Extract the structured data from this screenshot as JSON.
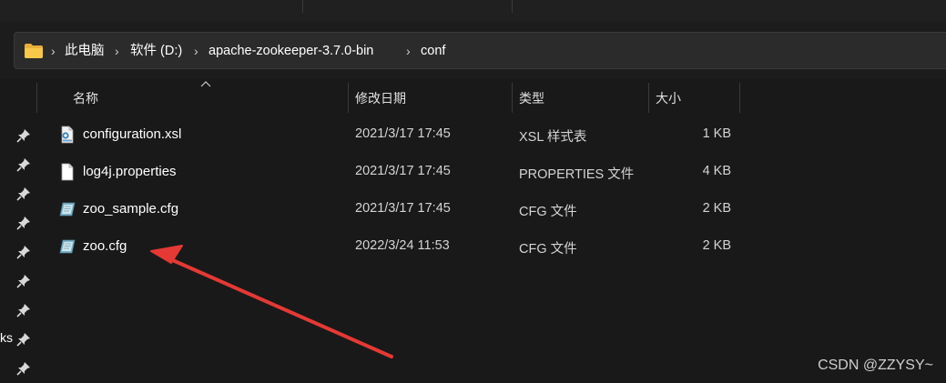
{
  "address_bar": {
    "crumbs": [
      "此电脑",
      "软件 (D:)",
      "apache-zookeeper-3.7.0-bin",
      "conf"
    ]
  },
  "columns": {
    "name": "名称",
    "modified": "修改日期",
    "type": "类型",
    "size": "大小"
  },
  "files": [
    {
      "name": "configuration.xsl",
      "modified": "2021/3/17 17:45",
      "type": "XSL 样式表",
      "size": "1 KB",
      "icon": "xsl-file-icon"
    },
    {
      "name": "log4j.properties",
      "modified": "2021/3/17 17:45",
      "type": "PROPERTIES 文件",
      "size": "4 KB",
      "icon": "blank-file-icon"
    },
    {
      "name": "zoo_sample.cfg",
      "modified": "2021/3/17 17:45",
      "type": "CFG 文件",
      "size": "2 KB",
      "icon": "cfg-file-icon"
    },
    {
      "name": "zoo.cfg",
      "modified": "2022/3/24 11:53",
      "type": "CFG 文件",
      "size": "2 KB",
      "icon": "cfg-file-icon"
    }
  ],
  "navigation_pane": {
    "partial_label": "ks"
  },
  "annotation": {
    "arrow_color": "#e53935",
    "target": "zoo.cfg"
  },
  "watermark": "CSDN @ZZYSY~"
}
